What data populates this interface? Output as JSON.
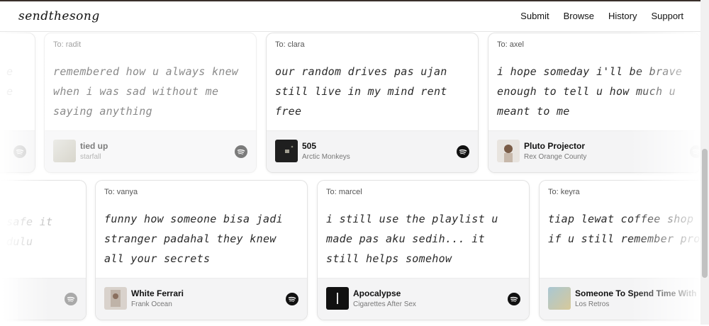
{
  "nav": {
    "logo": "sendthesong",
    "links": [
      "Submit",
      "Browse",
      "History",
      "Support"
    ]
  },
  "row1": [
    {
      "to": "To: radit",
      "message": "remembered how u always knew when i was sad without me saying anything",
      "song": "tied up",
      "artist": "starfall"
    },
    {
      "to": "To: clara",
      "message": "our random drives pas ujan still live in my mind rent free",
      "song": "505",
      "artist": "Arctic Monkeys"
    },
    {
      "to": "To: axel",
      "message": "i hope someday i'll be brave enough to tell u how much u meant to me",
      "song": "Pluto Projector",
      "artist": "Rex Orange County"
    }
  ],
  "row1_partial_left": {
    "line1": "e",
    "line2": "e"
  },
  "row2": [
    {
      "to": "To: vanya",
      "message": "funny how someone bisa jadi stranger padahal they knew all your secrets",
      "song": "White Ferrari",
      "artist": "Frank Ocean"
    },
    {
      "to": "To: marcel",
      "message": "i still use the playlist u made pas aku sedih... it still helps somehow",
      "song": "Apocalypse",
      "artist": "Cigarettes After Sex"
    },
    {
      "to": "To: keyra",
      "message": "tiap lewat coffee shop i wonder if u still remember promises",
      "song": "Someone To Spend Time With",
      "artist": "Los Retros"
    }
  ],
  "row2_partial_left": {
    "line1": "safe it",
    "line2": "dulu"
  },
  "icons": {
    "spotify": "spotify-icon"
  },
  "colors": {
    "spotify_badge": "#111111",
    "topline": "#3a2f2a"
  }
}
